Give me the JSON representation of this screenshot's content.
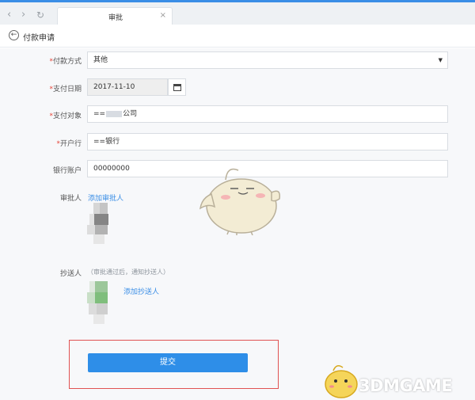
{
  "browser": {
    "tab_title": "审批",
    "tab_close": "×",
    "nav_back": "‹",
    "nav_forward": "›",
    "nav_reload": "↻"
  },
  "header": {
    "back_icon": "←",
    "title": "付款申请"
  },
  "form": {
    "payment_method": {
      "label": "付款方式",
      "value": "其他",
      "caret": "▼"
    },
    "payment_date": {
      "label": "支付日期",
      "value": "2017-11-10"
    },
    "payee": {
      "label": "支付对象",
      "value_prefix": "==",
      "value_suffix": "公司"
    },
    "bank": {
      "label": "开户行",
      "value": "==银行"
    },
    "account": {
      "label": "银行账户",
      "value": "00000000"
    },
    "approver": {
      "label": "审批人",
      "add_link": "添加审批人"
    },
    "cc": {
      "label": "抄送人",
      "hint": "（审批通过后，通知抄送人）",
      "add_link": "添加抄送人"
    },
    "required_mark": "*",
    "submit_label": "提交"
  },
  "watermark": {
    "brand": "3DMGAME"
  },
  "colors": {
    "accent": "#2e8ee8",
    "required": "#e6463a",
    "highlight": "#e05252"
  }
}
